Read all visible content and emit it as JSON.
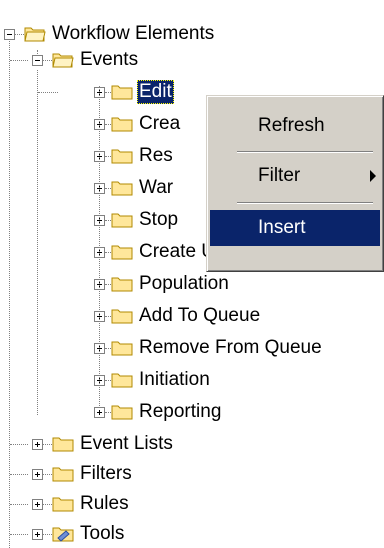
{
  "tree": {
    "root": {
      "label": "Workflow Elements",
      "icon": "folder-open-icon"
    },
    "events": {
      "label": "Events",
      "icon": "folder-open-icon"
    },
    "event_children": [
      {
        "label": "Edit",
        "selected": true
      },
      {
        "label": "Crea"
      },
      {
        "label": "Res"
      },
      {
        "label": "War"
      },
      {
        "label": "Stop"
      },
      {
        "label": "Create Unit"
      },
      {
        "label": "Population"
      },
      {
        "label": "Add To Queue"
      },
      {
        "label": "Remove From Queue"
      },
      {
        "label": "Initiation"
      },
      {
        "label": "Reporting"
      }
    ],
    "siblings": [
      {
        "label": "Event Lists",
        "icon": "folder-icon"
      },
      {
        "label": "Filters",
        "icon": "folder-icon"
      },
      {
        "label": "Rules",
        "icon": "folder-icon"
      },
      {
        "label": "Tools",
        "icon": "tools-folder-icon"
      }
    ]
  },
  "context_menu": {
    "items": [
      {
        "label": "Refresh"
      },
      {
        "label": "Filter",
        "submenu": true
      },
      {
        "label": "Insert",
        "highlighted": true
      }
    ]
  },
  "colors": {
    "selection": "#0a246a",
    "menu_face": "#d4d0c8",
    "folder_fill": "#ffe79b",
    "folder_stroke": "#b08a00"
  }
}
